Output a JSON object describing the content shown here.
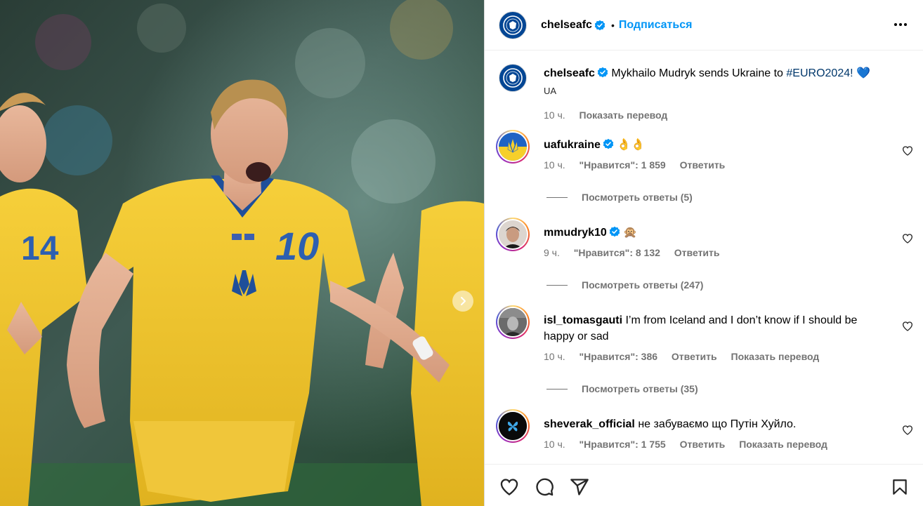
{
  "post": {
    "carousel_next": "chevron-right-icon"
  },
  "header": {
    "username": "chelseafc",
    "separator": "•",
    "follow_label": "Подписаться",
    "more_icon": "more-horizontal-icon"
  },
  "caption": {
    "username": "chelseafc",
    "text": "Mykhailo Mudryk sends Ukraine to",
    "hashtag": "#EURO2024!",
    "emoji": "💙",
    "sub": "UA",
    "time": "10 ч.",
    "translate": "Показать перевод"
  },
  "comments": [
    {
      "username": "uafukraine",
      "text": "👌👌",
      "time": "10 ч.",
      "likes": "\"Нравится\": 1 859",
      "reply": "Ответить",
      "translate": "",
      "replies": "Посмотреть ответы (5)"
    },
    {
      "username": "mmudryk10",
      "text": "🙊",
      "time": "9 ч.",
      "likes": "\"Нравится\": 8 132",
      "reply": "Ответить",
      "translate": "",
      "replies": "Посмотреть ответы (247)"
    },
    {
      "username": "isl_tomasgauti",
      "text": "I’m from Iceland and I don’t know if I should be happy or sad",
      "time": "10 ч.",
      "likes": "\"Нравится\": 386",
      "reply": "Ответить",
      "translate": "Показать перевод",
      "replies": "Посмотреть ответы (35)"
    },
    {
      "username": "sheverak_official",
      "text": "не забуваємо що Путін Хуйло.",
      "time": "10 ч.",
      "likes": "\"Нравится\": 1 755",
      "reply": "Ответить",
      "translate": "Показать перевод",
      "replies": ""
    }
  ],
  "actions": {
    "like": "heart-icon",
    "comment": "comment-icon",
    "share": "send-icon",
    "save": "bookmark-icon"
  },
  "colors": {
    "link": "#0095f6",
    "hashtag": "#00376b",
    "meta": "#737373",
    "jersey": "#f2c62f"
  }
}
